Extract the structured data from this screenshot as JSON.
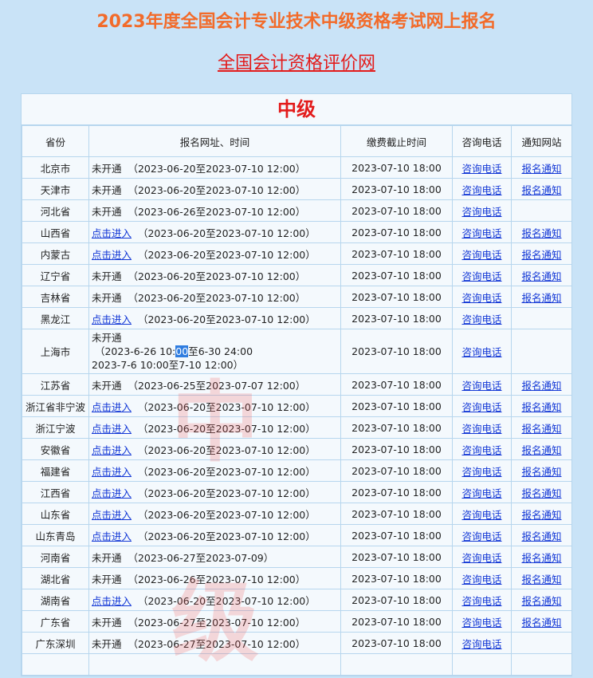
{
  "header": {
    "title": "2023年度全国会计专业技术中级资格考试网上报名",
    "site_link": "全国会计资格评价网"
  },
  "level_title": "中级",
  "watermark": {
    "char1": "中",
    "char2": "级"
  },
  "colors": {
    "title": "#f26b2a",
    "link_red": "#e31b1b",
    "link_blue": "#1338d6",
    "background": "#c9e3f7"
  },
  "table": {
    "headers": {
      "province": "省份",
      "url_time": "报名网址、时间",
      "deadline": "缴费截止时间",
      "phone": "咨询电话",
      "notice": "通知网站"
    },
    "rows": [
      {
        "province": "北京市",
        "entry": "未开通",
        "time": "（2023-06-20至2023-07-10 12:00）",
        "deadline": "2023-07-10 18:00",
        "phone": "咨询电话",
        "notice": "报名通知"
      },
      {
        "province": "天津市",
        "entry": "未开通",
        "time": "（2023-06-20至2023-07-10 12:00）",
        "deadline": "2023-07-10 18:00",
        "phone": "咨询电话",
        "notice": "报名通知"
      },
      {
        "province": "河北省",
        "entry": "未开通",
        "time": "（2023-06-26至2023-07-10 12:00）",
        "deadline": "2023-07-10 18:00",
        "phone": "咨询电话",
        "notice": ""
      },
      {
        "province": "山西省",
        "entry": "点击进入",
        "time": "（2023-06-20至2023-07-10 12:00）",
        "deadline": "2023-07-10 18:00",
        "phone": "咨询电话",
        "notice": "报名通知"
      },
      {
        "province": "内蒙古",
        "entry": "点击进入",
        "time": "（2023-06-20至2023-07-10 12:00）",
        "deadline": "2023-07-10 18:00",
        "phone": "咨询电话",
        "notice": "报名通知"
      },
      {
        "province": "辽宁省",
        "entry": "未开通",
        "time": "（2023-06-20至2023-07-10 12:00）",
        "deadline": "2023-07-10 18:00",
        "phone": "咨询电话",
        "notice": "报名通知"
      },
      {
        "province": "吉林省",
        "entry": "未开通",
        "time": "（2023-06-20至2023-07-10 12:00）",
        "deadline": "2023-07-10 18:00",
        "phone": "咨询电话",
        "notice": "报名通知"
      },
      {
        "province": "黑龙江",
        "entry": "点击进入",
        "time": "（2023-06-20至2023-07-10 12:00）",
        "deadline": "2023-07-10 18:00",
        "phone": "咨询电话",
        "notice": ""
      },
      {
        "province": "上海市",
        "entry": "未开通",
        "line1_pre": "（2023-6-26 10:",
        "line1_sel": "00",
        "line1_post": "至6-30 24:00",
        "line2": "2023-7-6 10:00至7-10 12:00）",
        "deadline": "2023-07-10 18:00",
        "phone": "咨询电话",
        "notice": ""
      },
      {
        "province": "江苏省",
        "entry": "未开通",
        "time": "（2023-06-25至2023-07-07 12:00）",
        "deadline": "2023-07-10 18:00",
        "phone": "咨询电话",
        "notice": "报名通知"
      },
      {
        "province": "浙江省非宁波",
        "entry": "点击进入",
        "time": "（2023-06-20至2023-07-10 12:00）",
        "deadline": "2023-07-10 18:00",
        "phone": "咨询电话",
        "notice": "报名通知"
      },
      {
        "province": "浙江宁波",
        "entry": "点击进入",
        "time": "（2023-06-20至2023-07-10 12:00）",
        "deadline": "2023-07-10 18:00",
        "phone": "咨询电话",
        "notice": "报名通知"
      },
      {
        "province": "安徽省",
        "entry": "点击进入",
        "time": "（2023-06-20至2023-07-10 12:00）",
        "deadline": "2023-07-10 18:00",
        "phone": "咨询电话",
        "notice": "报名通知"
      },
      {
        "province": "福建省",
        "entry": "点击进入",
        "time": "（2023-06-20至2023-07-10 12:00）",
        "deadline": "2023-07-10 18:00",
        "phone": "咨询电话",
        "notice": "报名通知"
      },
      {
        "province": "江西省",
        "entry": "点击进入",
        "time": "（2023-06-20至2023-07-10 12:00）",
        "deadline": "2023-07-10 18:00",
        "phone": "咨询电话",
        "notice": "报名通知"
      },
      {
        "province": "山东省",
        "entry": "点击进入",
        "time": "（2023-06-20至2023-07-10 12:00）",
        "deadline": "2023-07-10 18:00",
        "phone": "咨询电话",
        "notice": "报名通知"
      },
      {
        "province": "山东青岛",
        "entry": "点击进入",
        "time": "（2023-06-20至2023-07-10 12:00）",
        "deadline": "2023-07-10 18:00",
        "phone": "咨询电话",
        "notice": "报名通知"
      },
      {
        "province": "河南省",
        "entry": "未开通",
        "time": "（2023-06-27至2023-07-09）",
        "deadline": "2023-07-10 18:00",
        "phone": "咨询电话",
        "notice": "报名通知"
      },
      {
        "province": "湖北省",
        "entry": "未开通",
        "time": "（2023-06-26至2023-07-10 12:00）",
        "deadline": "2023-07-10 18:00",
        "phone": "咨询电话",
        "notice": "报名通知"
      },
      {
        "province": "湖南省",
        "entry": "点击进入",
        "time": "（2023-06-20至2023-07-10 12:00）",
        "deadline": "2023-07-10 18:00",
        "phone": "咨询电话",
        "notice": "报名通知"
      },
      {
        "province": "广东省",
        "entry": "未开通",
        "time": "（2023-06-27至2023-07-10 12:00）",
        "deadline": "2023-07-10 18:00",
        "phone": "咨询电话",
        "notice": "报名通知"
      },
      {
        "province": "广东深圳",
        "entry": "未开通",
        "time": "（2023-06-27至2023-07-10 12:00）",
        "deadline": "2023-07-10 18:00",
        "phone": "咨询电话",
        "notice": ""
      },
      {
        "province": "",
        "entry": "",
        "time": "",
        "deadline": "",
        "phone": "",
        "notice": ""
      }
    ]
  }
}
